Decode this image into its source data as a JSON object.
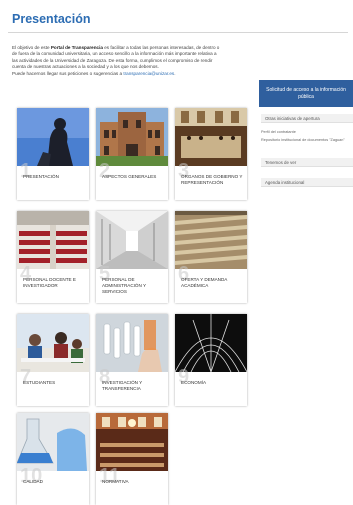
{
  "page": {
    "title": "Presentación",
    "intro_lines": [
      [
        "El objetivo de este ",
        "Portal de Transparencia",
        " es facilitar a todas las personas interesadas, de dentro o"
      ],
      [
        "de fuera de la comunidad universitaria, un acceso sencillo a la información más importante relativa a"
      ],
      [
        "las actividades de la Universidad de Zaragoza. De esta forma, cumplimos el compromiso de rendir"
      ],
      [
        "cuenta de nuestras actuaciones a la sociedad y a los que nos debemos."
      ],
      [
        "Puede hacernos llegar sus peticiones o sugerencias a ",
        "transparencia@unizar.es",
        "."
      ]
    ]
  },
  "tiles": [
    {
      "num": "1",
      "label": "PRESENTACIÓN",
      "icon": "statue-photo"
    },
    {
      "num": "2",
      "label": "ASPECTOS GENERALES",
      "icon": "building-photo"
    },
    {
      "num": "3",
      "label": "ÓRGANOS DE GOBIERNO Y REPRESENTACIÓN",
      "icon": "assembly-hall-photo"
    },
    {
      "num": "4",
      "label": "PERSONAL DOCENTE E INVESTIGADOR",
      "icon": "lecture-hall-photo"
    },
    {
      "num": "5",
      "label": "PERSONAL DE ADMINISTRACIÓN Y SERVICIOS",
      "icon": "corridor-photo"
    },
    {
      "num": "6",
      "label": "OFERTA Y DEMANDA ACADÉMICA",
      "icon": "auditorium-photo"
    },
    {
      "num": "7",
      "label": "ESTUDIANTES",
      "icon": "students-photo"
    },
    {
      "num": "8",
      "label": "INVESTIGACIÓN Y TRANSFERENCIA",
      "icon": "lab-samples-photo"
    },
    {
      "num": "9",
      "label": "ECONOMÍA",
      "icon": "iron-ceiling-photo"
    },
    {
      "num": "10",
      "label": "CALIDAD",
      "icon": "lab-flask-photo"
    },
    {
      "num": "11",
      "label": "NORMATIVA",
      "icon": "paraninfo-photo"
    }
  ],
  "sidebar": {
    "primary_button": "Solicitud de acceso a la información pública",
    "options": [
      "Otras iniciativas de apertura",
      "Perfil del contratante",
      "Repositorio institucional de documentos \"Zaguan\"",
      "Tenemos de ver",
      "Agenda institucional"
    ]
  },
  "colors": {
    "title_blue": "#2d6db3",
    "sidebar_blue": "#2f5f9e",
    "tile_number_gray": "#c9c9c9"
  }
}
